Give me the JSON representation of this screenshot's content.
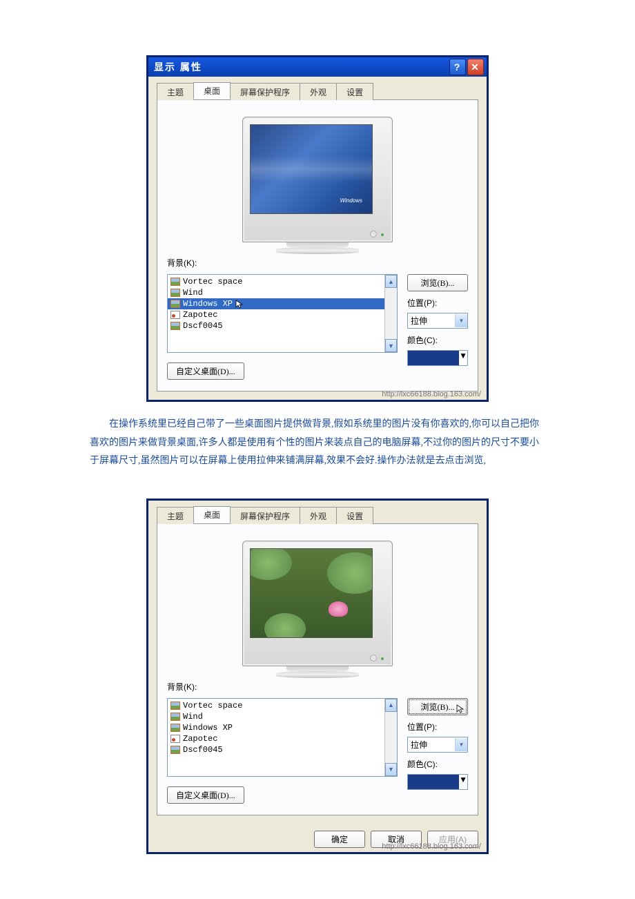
{
  "window_title": "显示 属性",
  "tabs": [
    "主题",
    "桌面",
    "屏幕保护程序",
    "外观",
    "设置"
  ],
  "active_tab": 1,
  "labels": {
    "background": "背景(K):",
    "position": "位置(P):",
    "color": "颜色(C):"
  },
  "buttons": {
    "browse": "浏览(B)...",
    "customize": "自定义桌面(D)...",
    "ok": "确定",
    "cancel": "取消",
    "apply": "应用(A)"
  },
  "position_value": "拉伸",
  "color_value": "#1a3a8a",
  "dialog1": {
    "items": [
      "Vortec space",
      "Wind",
      "Windows XP",
      "Zapotec",
      "Dscf0045"
    ],
    "selected": 2
  },
  "dialog2": {
    "items": [
      "Vortec space",
      "Wind",
      "Windows XP",
      "Zapotec",
      "Dscf0045"
    ],
    "selected": -1
  },
  "watermark": "http://lxc66188.blog.163.com/",
  "paragraph": "在操作系统里已经自己带了一些桌面图片提供做背景,假如系统里的图片没有你喜欢的,你可以自己把你喜欢的图片来做背景桌面,许多人都是使用有个性的图片来装点自己的电脑屏幕,不过你的图片的尺寸不要小于屏幕尺寸,虽然图片可以在屏幕上使用拉伸来铺满屏幕,效果不会好.操作办法就是去点击浏览,",
  "preview_logo": "Windows"
}
